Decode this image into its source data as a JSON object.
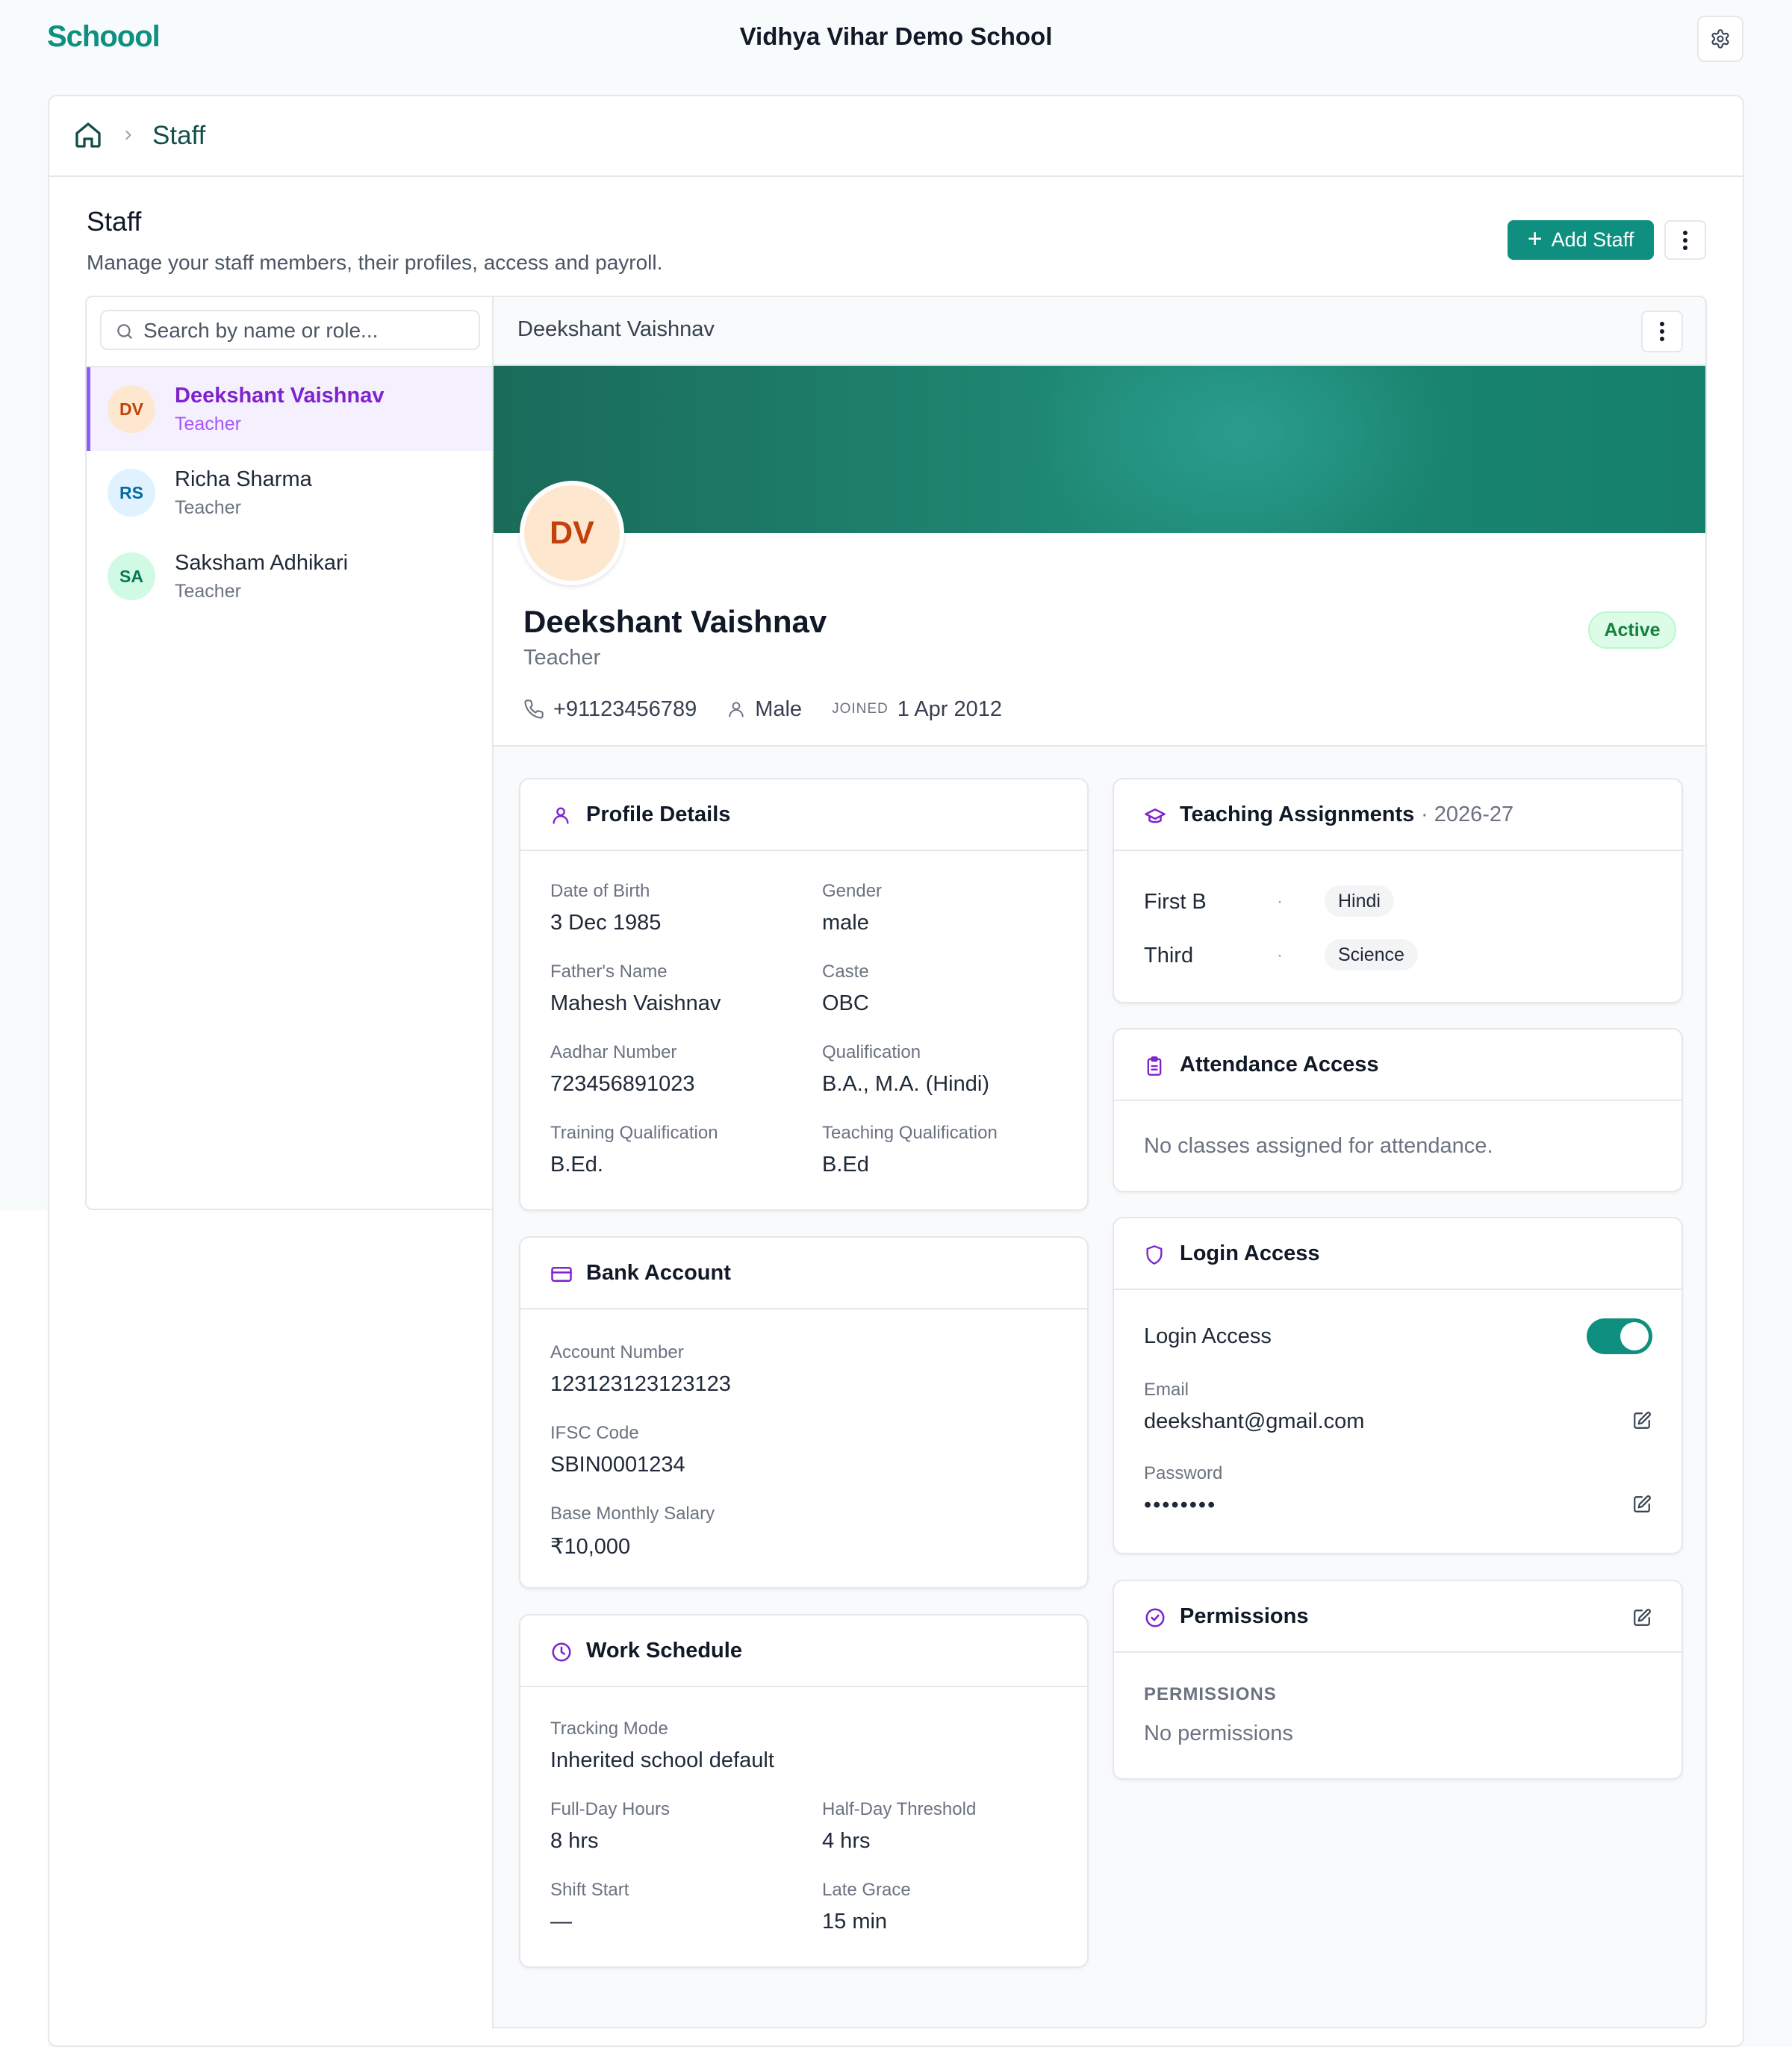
{
  "app": {
    "logo": "Schoool",
    "school_name": "Vidhya Vihar Demo School"
  },
  "breadcrumb": {
    "current": "Staff"
  },
  "page": {
    "title": "Staff",
    "subtitle": "Manage your staff members, their profiles, access and payroll.",
    "add_button": "Add Staff"
  },
  "search": {
    "placeholder": "Search by name or role..."
  },
  "staff_list": [
    {
      "initials": "DV",
      "name": "Deekshant Vaishnav",
      "role": "Teacher",
      "active": true,
      "avatar_bg": "#fde8cf",
      "avatar_fg": "#c2410c"
    },
    {
      "initials": "RS",
      "name": "Richa Sharma",
      "role": "Teacher",
      "active": false,
      "avatar_bg": "#e0f2fe",
      "avatar_fg": "#0369a1"
    },
    {
      "initials": "SA",
      "name": "Saksham Adhikari",
      "role": "Teacher",
      "active": false,
      "avatar_bg": "#d1fae5",
      "avatar_fg": "#047857"
    }
  ],
  "detail": {
    "header_name": "Deekshant Vaishnav",
    "initials": "DV",
    "name": "Deekshant Vaishnav",
    "role": "Teacher",
    "status": "Active",
    "phone": "+91123456789",
    "gender": "Male",
    "joined_label": "JOINED",
    "joined": "1 Apr 2012"
  },
  "profile_details": {
    "title": "Profile Details",
    "fields": [
      {
        "label": "Date of Birth",
        "value": "3 Dec 1985"
      },
      {
        "label": "Gender",
        "value": "male"
      },
      {
        "label": "Father's Name",
        "value": "Mahesh Vaishnav"
      },
      {
        "label": "Caste",
        "value": "OBC"
      },
      {
        "label": "Aadhar Number",
        "value": "723456891023"
      },
      {
        "label": "Qualification",
        "value": "B.A., M.A. (Hindi)"
      },
      {
        "label": "Training Qualification",
        "value": "B.Ed."
      },
      {
        "label": "Teaching Qualification",
        "value": "B.Ed"
      }
    ]
  },
  "bank_account": {
    "title": "Bank Account",
    "fields": [
      {
        "label": "Account Number",
        "value": "123123123123123"
      },
      {
        "label": "IFSC Code",
        "value": "SBIN0001234"
      },
      {
        "label": "Base Monthly Salary",
        "value": "₹10,000"
      }
    ]
  },
  "work_schedule": {
    "title": "Work Schedule",
    "fields": [
      {
        "label": "Tracking Mode",
        "value": "Inherited school default"
      },
      {
        "label": "Full-Day Hours",
        "value": "8 hrs"
      },
      {
        "label": "Half-Day Threshold",
        "value": "4 hrs"
      },
      {
        "label": "Shift Start",
        "value": "—"
      },
      {
        "label": "Late Grace",
        "value": "15 min"
      }
    ]
  },
  "teaching_assignments": {
    "title": "Teaching Assignments",
    "year": "· 2026-27",
    "rows": [
      {
        "class": "First B",
        "subject": "Hindi"
      },
      {
        "class": "Third",
        "subject": "Science"
      }
    ]
  },
  "attendance_access": {
    "title": "Attendance Access",
    "empty": "No classes assigned for attendance."
  },
  "login_access": {
    "title": "Login Access",
    "toggle_label": "Login Access",
    "enabled": true,
    "email_label": "Email",
    "email": "deekshant@gmail.com",
    "password_label": "Password",
    "password": "••••••••"
  },
  "permissions": {
    "title": "Permissions",
    "section_label": "PERMISSIONS",
    "empty": "No permissions"
  }
}
